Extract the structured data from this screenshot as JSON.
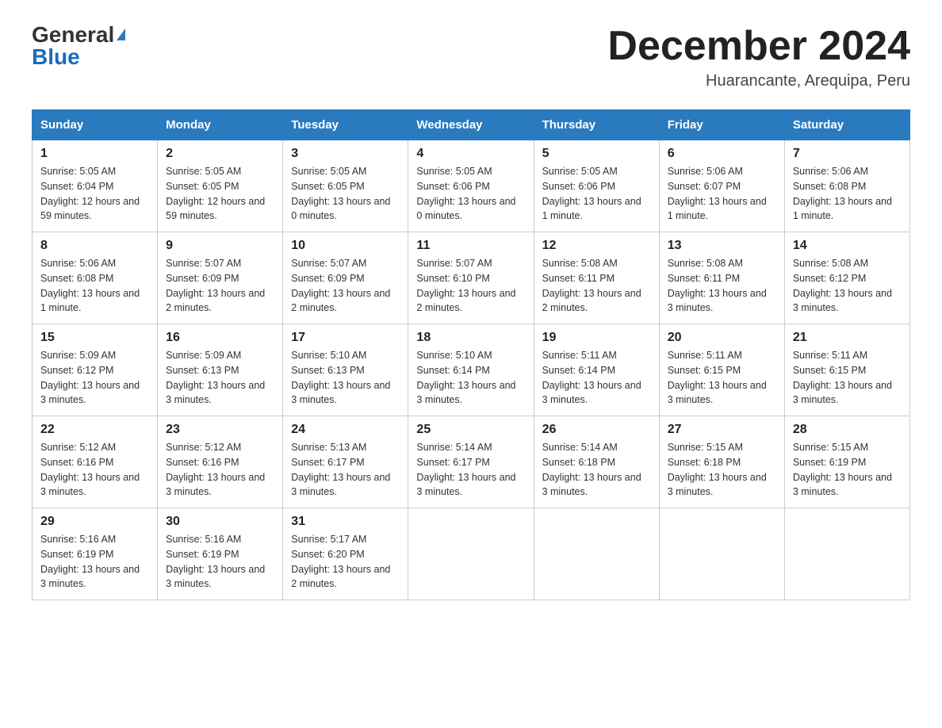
{
  "header": {
    "logo": {
      "general": "General",
      "blue": "Blue",
      "triangle": "▶"
    },
    "title": "December 2024",
    "location": "Huarancante, Arequipa, Peru"
  },
  "weekdays": [
    "Sunday",
    "Monday",
    "Tuesday",
    "Wednesday",
    "Thursday",
    "Friday",
    "Saturday"
  ],
  "weeks": [
    [
      {
        "day": "1",
        "sunrise": "5:05 AM",
        "sunset": "6:04 PM",
        "daylight": "12 hours and 59 minutes."
      },
      {
        "day": "2",
        "sunrise": "5:05 AM",
        "sunset": "6:05 PM",
        "daylight": "12 hours and 59 minutes."
      },
      {
        "day": "3",
        "sunrise": "5:05 AM",
        "sunset": "6:05 PM",
        "daylight": "13 hours and 0 minutes."
      },
      {
        "day": "4",
        "sunrise": "5:05 AM",
        "sunset": "6:06 PM",
        "daylight": "13 hours and 0 minutes."
      },
      {
        "day": "5",
        "sunrise": "5:05 AM",
        "sunset": "6:06 PM",
        "daylight": "13 hours and 1 minute."
      },
      {
        "day": "6",
        "sunrise": "5:06 AM",
        "sunset": "6:07 PM",
        "daylight": "13 hours and 1 minute."
      },
      {
        "day": "7",
        "sunrise": "5:06 AM",
        "sunset": "6:08 PM",
        "daylight": "13 hours and 1 minute."
      }
    ],
    [
      {
        "day": "8",
        "sunrise": "5:06 AM",
        "sunset": "6:08 PM",
        "daylight": "13 hours and 1 minute."
      },
      {
        "day": "9",
        "sunrise": "5:07 AM",
        "sunset": "6:09 PM",
        "daylight": "13 hours and 2 minutes."
      },
      {
        "day": "10",
        "sunrise": "5:07 AM",
        "sunset": "6:09 PM",
        "daylight": "13 hours and 2 minutes."
      },
      {
        "day": "11",
        "sunrise": "5:07 AM",
        "sunset": "6:10 PM",
        "daylight": "13 hours and 2 minutes."
      },
      {
        "day": "12",
        "sunrise": "5:08 AM",
        "sunset": "6:11 PM",
        "daylight": "13 hours and 2 minutes."
      },
      {
        "day": "13",
        "sunrise": "5:08 AM",
        "sunset": "6:11 PM",
        "daylight": "13 hours and 3 minutes."
      },
      {
        "day": "14",
        "sunrise": "5:08 AM",
        "sunset": "6:12 PM",
        "daylight": "13 hours and 3 minutes."
      }
    ],
    [
      {
        "day": "15",
        "sunrise": "5:09 AM",
        "sunset": "6:12 PM",
        "daylight": "13 hours and 3 minutes."
      },
      {
        "day": "16",
        "sunrise": "5:09 AM",
        "sunset": "6:13 PM",
        "daylight": "13 hours and 3 minutes."
      },
      {
        "day": "17",
        "sunrise": "5:10 AM",
        "sunset": "6:13 PM",
        "daylight": "13 hours and 3 minutes."
      },
      {
        "day": "18",
        "sunrise": "5:10 AM",
        "sunset": "6:14 PM",
        "daylight": "13 hours and 3 minutes."
      },
      {
        "day": "19",
        "sunrise": "5:11 AM",
        "sunset": "6:14 PM",
        "daylight": "13 hours and 3 minutes."
      },
      {
        "day": "20",
        "sunrise": "5:11 AM",
        "sunset": "6:15 PM",
        "daylight": "13 hours and 3 minutes."
      },
      {
        "day": "21",
        "sunrise": "5:11 AM",
        "sunset": "6:15 PM",
        "daylight": "13 hours and 3 minutes."
      }
    ],
    [
      {
        "day": "22",
        "sunrise": "5:12 AM",
        "sunset": "6:16 PM",
        "daylight": "13 hours and 3 minutes."
      },
      {
        "day": "23",
        "sunrise": "5:12 AM",
        "sunset": "6:16 PM",
        "daylight": "13 hours and 3 minutes."
      },
      {
        "day": "24",
        "sunrise": "5:13 AM",
        "sunset": "6:17 PM",
        "daylight": "13 hours and 3 minutes."
      },
      {
        "day": "25",
        "sunrise": "5:14 AM",
        "sunset": "6:17 PM",
        "daylight": "13 hours and 3 minutes."
      },
      {
        "day": "26",
        "sunrise": "5:14 AM",
        "sunset": "6:18 PM",
        "daylight": "13 hours and 3 minutes."
      },
      {
        "day": "27",
        "sunrise": "5:15 AM",
        "sunset": "6:18 PM",
        "daylight": "13 hours and 3 minutes."
      },
      {
        "day": "28",
        "sunrise": "5:15 AM",
        "sunset": "6:19 PM",
        "daylight": "13 hours and 3 minutes."
      }
    ],
    [
      {
        "day": "29",
        "sunrise": "5:16 AM",
        "sunset": "6:19 PM",
        "daylight": "13 hours and 3 minutes."
      },
      {
        "day": "30",
        "sunrise": "5:16 AM",
        "sunset": "6:19 PM",
        "daylight": "13 hours and 3 minutes."
      },
      {
        "day": "31",
        "sunrise": "5:17 AM",
        "sunset": "6:20 PM",
        "daylight": "13 hours and 2 minutes."
      },
      null,
      null,
      null,
      null
    ]
  ],
  "labels": {
    "sunrise": "Sunrise:",
    "sunset": "Sunset:",
    "daylight": "Daylight:"
  }
}
